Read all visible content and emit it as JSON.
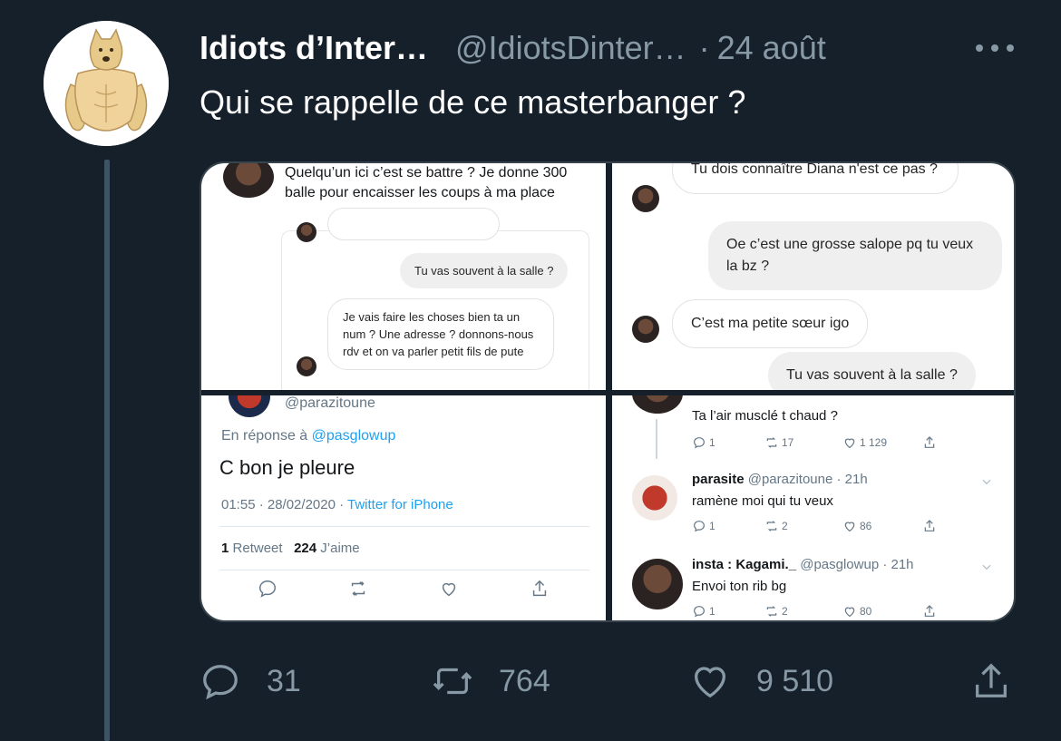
{
  "tweet": {
    "author_name": "Idiots d’Inter…",
    "handle": "@IdiotsDinter…",
    "separator": "·",
    "date": "24 août",
    "text": "Qui se rappelle de ce masterbanger ?"
  },
  "media": {
    "panel1": {
      "post_text": "Quelqu’un ici c’est se battre ? Je donne 300 balle pour encaisser les coups à ma place",
      "dm_out": "Tu vas souvent à la salle ?",
      "dm_in": "Je vais faire les choses bien ta un num ? Une adresse ? donnons-nous rdv et on va parler petit fils de pute"
    },
    "panel2": {
      "msg1": "Tu dois connaître Diana n'est ce pas ?",
      "msg2": "Oe c’est une grosse salope pq tu veux la bz ?",
      "msg3": "C’est ma petite sœur igo",
      "msg4": "Tu vas souvent à la salle ?"
    },
    "panel3": {
      "handle": "@parazitoune",
      "reply_prefix": "En réponse à",
      "reply_handle": "@pasglowup",
      "text": "C bon je pleure",
      "time": "01:55 · 28/02/2020 ·",
      "source": "Twitter for iPhone",
      "retweet_count": "1",
      "retweet_label": "Retweet",
      "like_count": "224",
      "like_label": "J’aime"
    },
    "panel4": {
      "top_text": "Ta l’air musclé t chaud ?",
      "top_stats": {
        "replies": "1",
        "retweets": "17",
        "likes": "1 129"
      },
      "reply1": {
        "name": "parasite",
        "handle": "@parazitoune · 21h",
        "text": "ramène moi qui tu veux",
        "replies": "1",
        "retweets": "2",
        "likes": "86"
      },
      "reply2": {
        "name": "insta : Kagami._",
        "handle": "@pasglowup · 21h",
        "text": "Envoi ton rib bg",
        "replies": "1",
        "retweets": "2",
        "likes": "80"
      }
    }
  },
  "actions": {
    "replies": "31",
    "retweets": "764",
    "likes": "9 510"
  },
  "colors": {
    "background": "#15202b",
    "secondary_text": "#8899a6",
    "link": "#1da1f2"
  }
}
